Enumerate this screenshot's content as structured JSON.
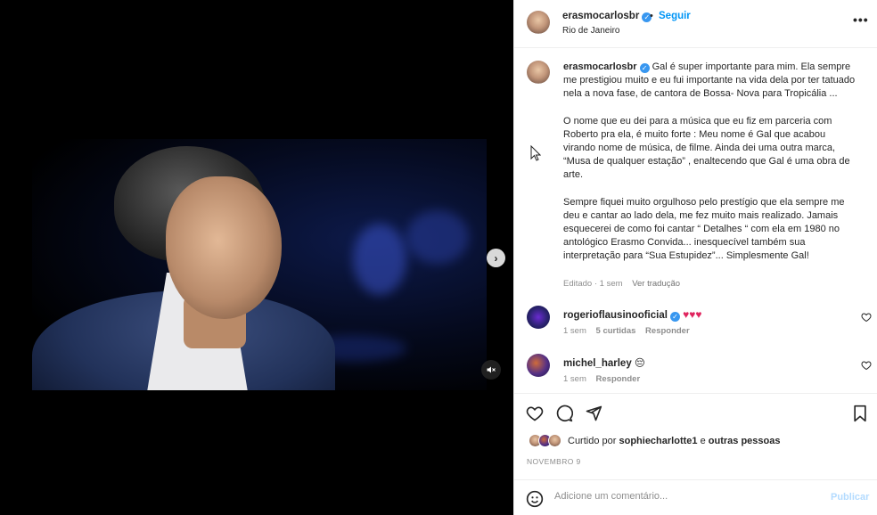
{
  "post_author": {
    "username": "erasmocarlosbr",
    "location": "Rio de Janeiro",
    "follow_label": "Seguir",
    "separator": "•"
  },
  "caption": {
    "username": "erasmocarlosbr",
    "paragraphs": [
      "Gal é super importante para mim. Ela sempre me prestigiou muito e eu fui importante na vida dela por ter tatuado nela a nova fase, de cantora de Bossa- Nova para Tropicália ...",
      "O nome que eu dei para a música que eu fiz em parceria com Roberto pra ela, é muito forte : Meu nome é Gal que acabou virando nome de música, de filme. Ainda dei uma outra marca, “Musa de qualquer estação” , enaltecendo que Gal é uma obra de arte.",
      "Sempre fiquei muito orgulhoso pelo prestígio que ela sempre me deu e cantar ao lado dela, me fez muito mais realizado. Jamais esquecerei de como foi cantar “ Detalhes “ com ela em 1980 no antológico Erasmo Convida... inesquecível também sua interpretação para “Sua Estupidez”... Simplesmente Gal!"
    ],
    "edited": "Editado · 1 sem",
    "see_translation": "Ver tradução"
  },
  "comments": [
    {
      "username": "rogerioflausinooficial",
      "verified": true,
      "text": "♥♥♥",
      "time": "1 sem",
      "likes": "5 curtidas",
      "reply": "Responder"
    },
    {
      "username": "michel_harley",
      "verified": false,
      "text": "😔",
      "time": "1 sem",
      "reply": "Responder"
    }
  ],
  "likes": {
    "prefix": "Curtido por",
    "user": "sophiecharlotte1",
    "middle": "e",
    "suffix": "outras pessoas"
  },
  "date": "NOVEMBRO 9",
  "add_comment": {
    "placeholder": "Adicione um comentário...",
    "publish_label": "Publicar"
  },
  "colors": {
    "accent": "#0095f6",
    "verified": "#3897f0",
    "heart": "#e0245e",
    "muted_text": "#8e8e8e"
  },
  "icons": {
    "media_next": "chevron-right-icon",
    "media_mute": "speaker-muted-icon",
    "like": "heart-icon",
    "comment": "comment-bubble-icon",
    "share": "paper-plane-icon",
    "save": "bookmark-icon",
    "emoji": "smiley-icon",
    "options": "more-dots-icon"
  }
}
